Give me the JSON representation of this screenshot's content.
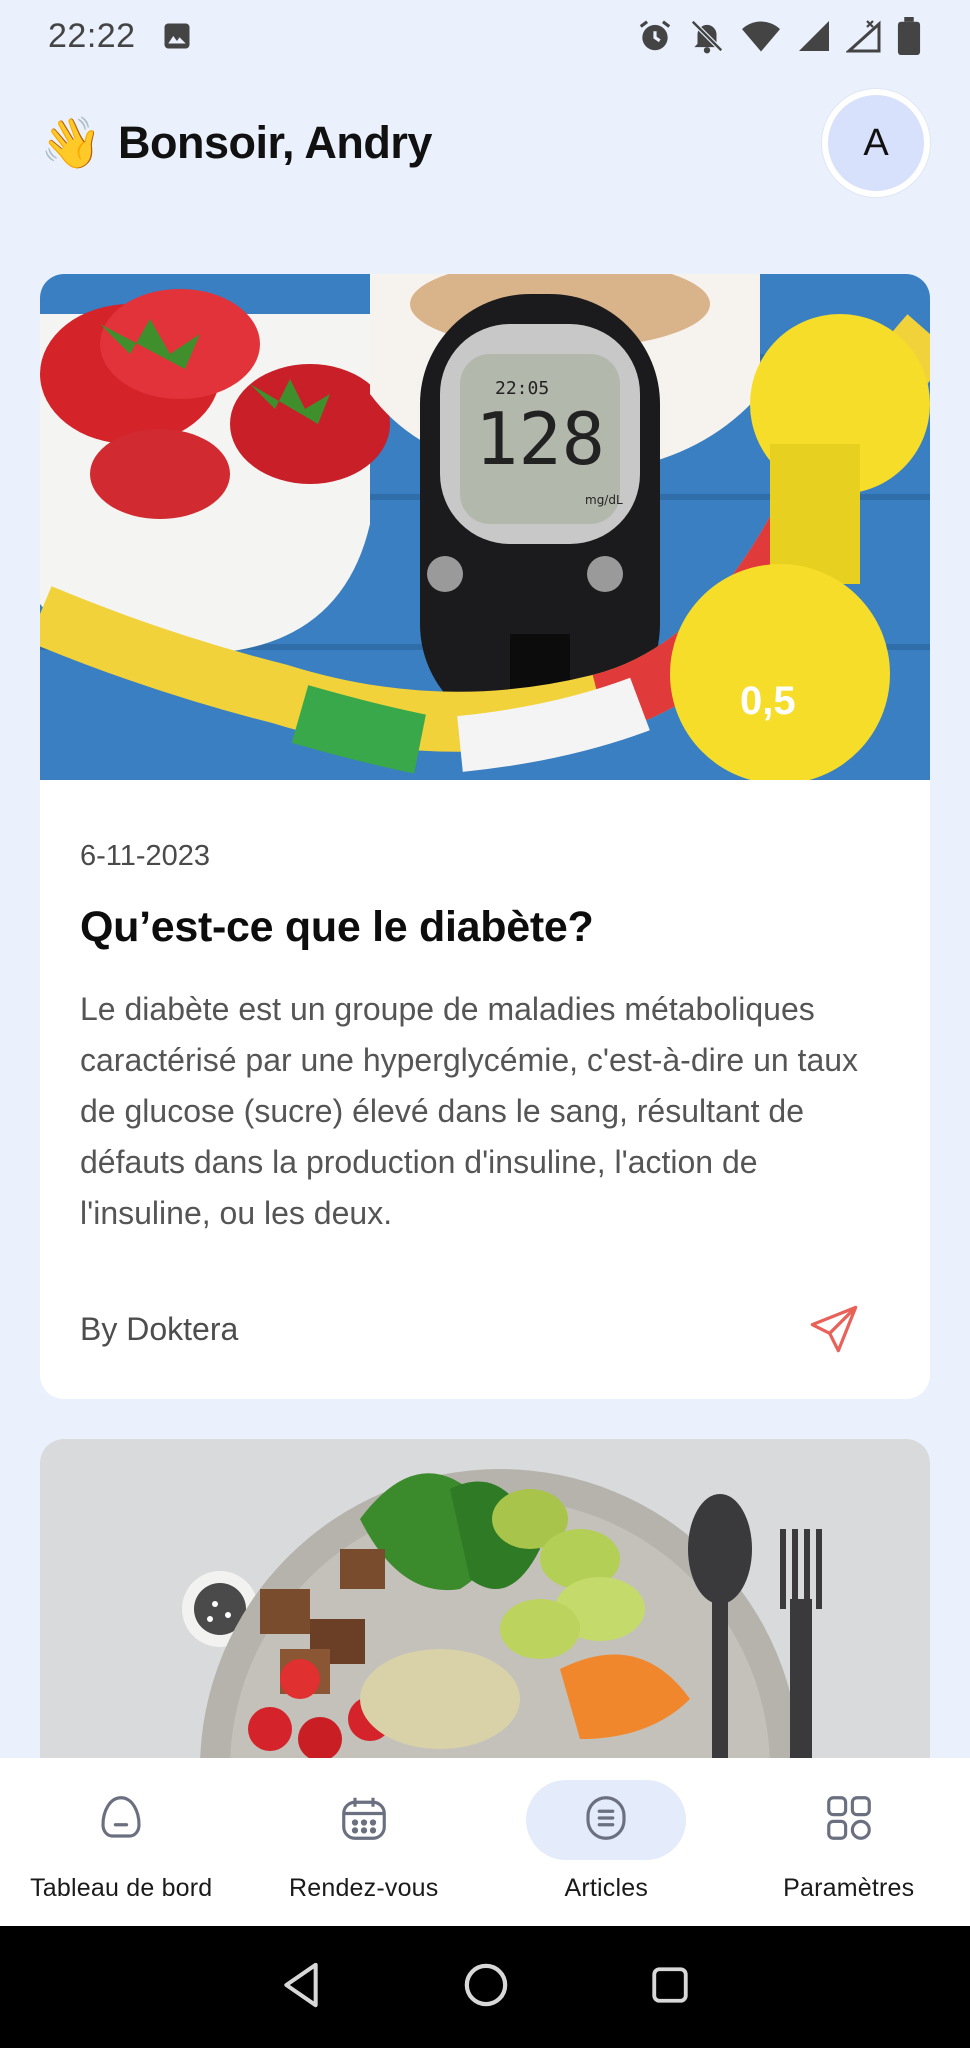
{
  "status_bar": {
    "time": "22:22",
    "icons_left": [
      "image-icon"
    ],
    "icons_right": [
      "alarm-icon",
      "notifications-off-icon",
      "wifi-icon",
      "signal-icon",
      "signal-x-icon",
      "battery-icon"
    ]
  },
  "header": {
    "wave_emoji": "👋",
    "greeting": "Bonsoir, Andry",
    "avatar_initial": "A"
  },
  "articles": [
    {
      "image_description": "glucometer-strawberries-dumbbell",
      "image_text": {
        "meter_reading": "128",
        "meter_time": "22:05",
        "meter_unit": "mg/dL",
        "dumbbell_label": "0,5"
      },
      "date": "6-11-2023",
      "title": "Qu’est-ce que le diabète?",
      "text": "Le diabète est un groupe de maladies métaboliques caractérisé par une hyperglycémie, c'est-à-dire un taux de glucose (sucre) élevé dans le sang, résultant de défauts dans la production d'insuline, l'action de l'insuline, ou les deux.",
      "author": "By Doktera"
    },
    {
      "image_description": "healthy-bowl-avocado-salad"
    }
  ],
  "bottom_nav": [
    {
      "label": "Tableau de bord",
      "icon": "dashboard-icon",
      "active": false
    },
    {
      "label": "Rendez-vous",
      "icon": "calendar-icon",
      "active": false
    },
    {
      "label": "Articles",
      "icon": "articles-icon",
      "active": true
    },
    {
      "label": "Paramètres",
      "icon": "grid-icon",
      "active": false
    }
  ],
  "colors": {
    "background": "#eaf1fd",
    "card": "#ffffff",
    "active_nav": "#e4ebfa",
    "share_icon": "#e8625a",
    "nav_icon": "#6b7080"
  }
}
